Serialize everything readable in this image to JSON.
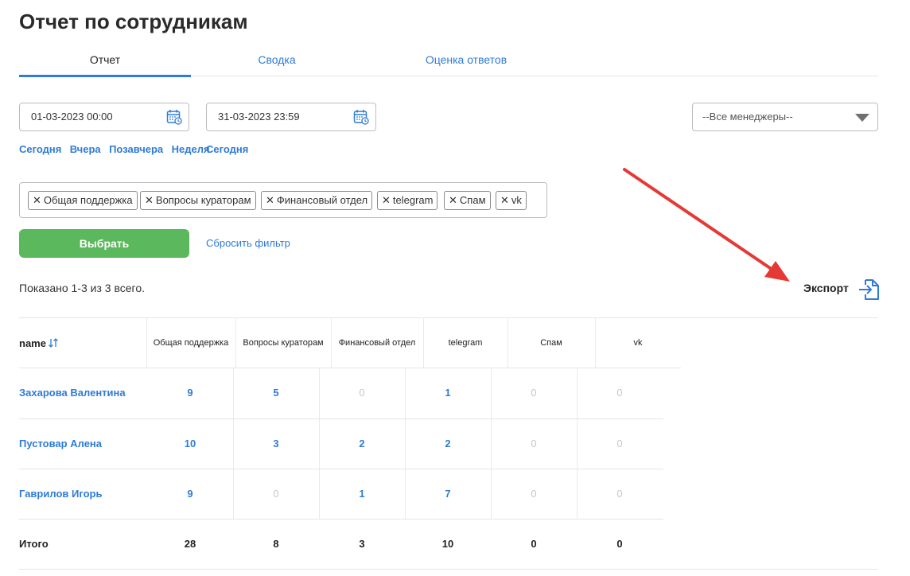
{
  "page": {
    "title": "Отчет по сотрудникам"
  },
  "tabs": [
    {
      "label": "Отчет",
      "active": true
    },
    {
      "label": "Сводка",
      "active": false
    },
    {
      "label": "Оценка ответов",
      "active": false
    }
  ],
  "filters": {
    "date_from": "01-03-2023 00:00",
    "date_to": "31-03-2023 23:59",
    "quick_from": [
      "Сегодня",
      "Вчера",
      "Позавчера",
      "Неделя"
    ],
    "quick_to": [
      "Сегодня"
    ],
    "manager_select": "--Все менеджеры--",
    "tags": [
      "Общая поддержка",
      "Вопросы кураторам",
      "Финансовый отдел",
      "telegram",
      "Спам",
      "vk"
    ],
    "submit_label": "Выбрать",
    "reset_label": "Сбросить фильтр"
  },
  "summary": "Показано 1-3 из 3 всего.",
  "export_label": "Экспорт",
  "table": {
    "name_header": "name",
    "columns": [
      "Общая поддержка",
      "Вопросы кураторам",
      "Финансовый отдел",
      "telegram",
      "Спам",
      "vk"
    ],
    "rows": [
      {
        "name": "Захарова Валентина",
        "values": [
          9,
          5,
          0,
          1,
          0,
          0
        ]
      },
      {
        "name": "Пустовар Алена",
        "values": [
          10,
          3,
          2,
          2,
          0,
          0
        ]
      },
      {
        "name": "Гаврилов Игорь",
        "values": [
          9,
          0,
          1,
          7,
          0,
          0
        ]
      }
    ],
    "total_label": "Итого",
    "totals": [
      28,
      8,
      3,
      10,
      0,
      0
    ]
  },
  "colors": {
    "accent": "#2f7bd6",
    "button": "#5cb85c",
    "annotation_arrow": "#e53935"
  },
  "icons": [
    "calendar-icon",
    "chevron-down-icon",
    "close-icon",
    "sort-icon",
    "export-icon"
  ]
}
